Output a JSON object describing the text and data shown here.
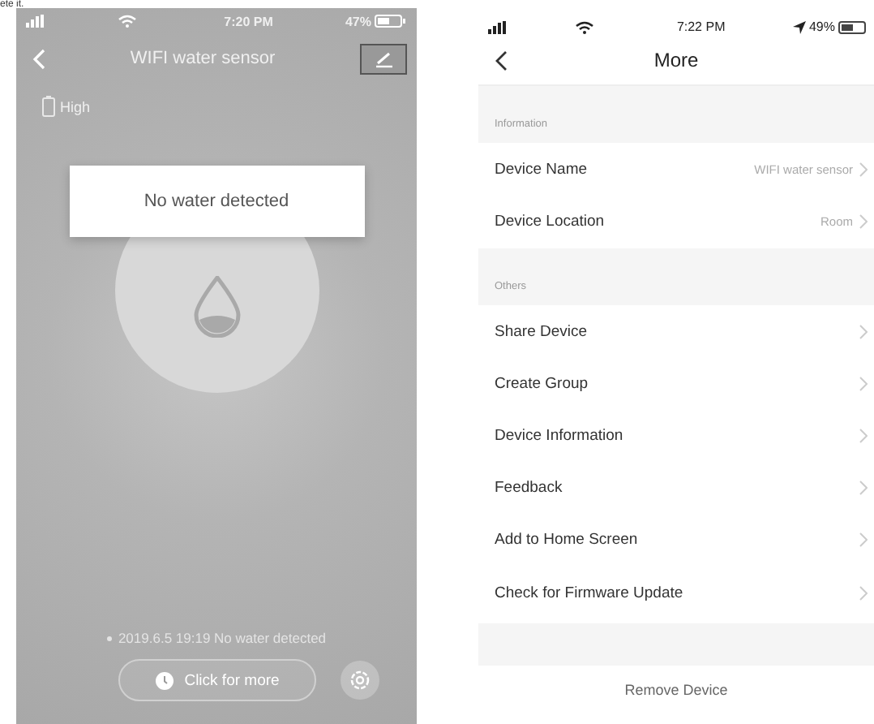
{
  "caption_fragment": "ete it.",
  "sensor_screen": {
    "status_bar": {
      "time": "7:20 PM",
      "battery": "47%"
    },
    "title": "WIFI water sensor",
    "battery_label": "High",
    "status_card": "No water detected",
    "log_entry": "2019.6.5 19:19 No water detected",
    "more_button": "Click for more"
  },
  "more_screen": {
    "status_bar": {
      "time": "7:22 PM",
      "battery": "49%"
    },
    "title": "More",
    "sections": [
      {
        "header": "Information",
        "rows": [
          {
            "label": "Device Name",
            "value": "WIFI water sensor"
          },
          {
            "label": "Device Location",
            "value": "Room"
          }
        ]
      },
      {
        "header": "Others",
        "rows": [
          {
            "label": "Share Device"
          },
          {
            "label": "Create Group"
          },
          {
            "label": "Device Information"
          },
          {
            "label": "Feedback"
          },
          {
            "label": "Add to Home Screen"
          },
          {
            "label": "Check for Firmware Update"
          }
        ]
      }
    ],
    "remove_button": "Remove Device"
  }
}
